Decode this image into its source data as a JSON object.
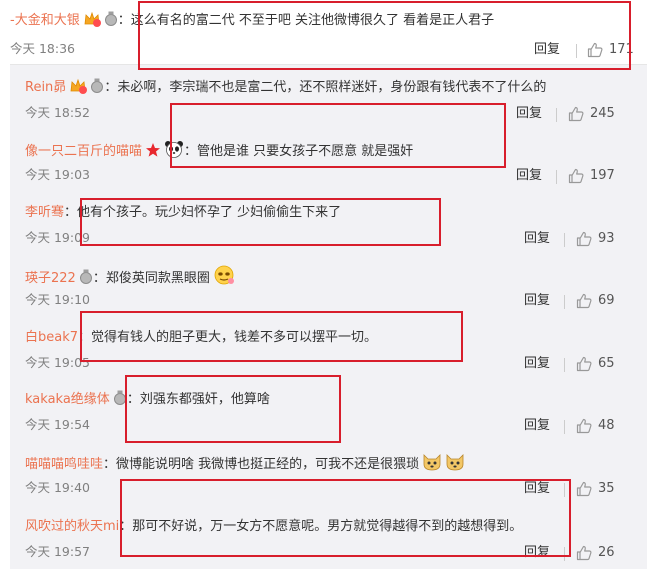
{
  "main_comment": {
    "username": "-大金和大银",
    "text": "这么有名的富二代 不至于吧 关注他微博很久了 看着是正人君子",
    "time": "今天 18:36",
    "reply_label": "回复",
    "like_count": "171"
  },
  "replies": [
    {
      "username": "Rein昴",
      "text": "未必啊，李宗瑞不也是富二代，还不照样迷奸，身份跟有钱代表不了什么的",
      "time": "今天 18:52",
      "reply_label": "回复",
      "like_count": "245"
    },
    {
      "username": "像一只二百斤的喵喵",
      "text": "管他是谁 只要女孩子不愿意 就是强奸",
      "time": "今天 19:03",
      "reply_label": "回复",
      "like_count": "197"
    },
    {
      "username": "李听骞",
      "text": "他有个孩子。玩少妇怀孕了  少妇偷偷生下来了",
      "time": "今天 19:09",
      "reply_label": "回复",
      "like_count": "93"
    },
    {
      "username": "瑛子222",
      "text": "郑俊英同款黑眼圈",
      "time": "今天 19:10",
      "reply_label": "回复",
      "like_count": "69"
    },
    {
      "username": "白beak7",
      "text": "觉得有钱人的胆子更大，钱差不多可以摆平一切。",
      "time": "今天 19:05",
      "reply_label": "回复",
      "like_count": "65"
    },
    {
      "username": "kakaka绝缘体",
      "text": "刘强东都强奸，他算啥",
      "time": "今天 19:54",
      "reply_label": "回复",
      "like_count": "48"
    },
    {
      "username": "喵喵喵鸣哇哇",
      "text": "微博能说明啥 我微博也挺正经的，可我不还是很猥琐",
      "time": "今天 19:40",
      "reply_label": "回复",
      "like_count": "35"
    },
    {
      "username": "风吹过的秋天mi",
      "text": "那可不好说，万一女方不愿意呢。男方就觉得越得不到的越想得到。",
      "time": "今天 19:57",
      "reply_label": "回复",
      "like_count": "26"
    }
  ],
  "colors": {
    "username": "#eb7350",
    "highlight_box": "#d81e2c",
    "reply_bg": "#f2f2f5"
  }
}
